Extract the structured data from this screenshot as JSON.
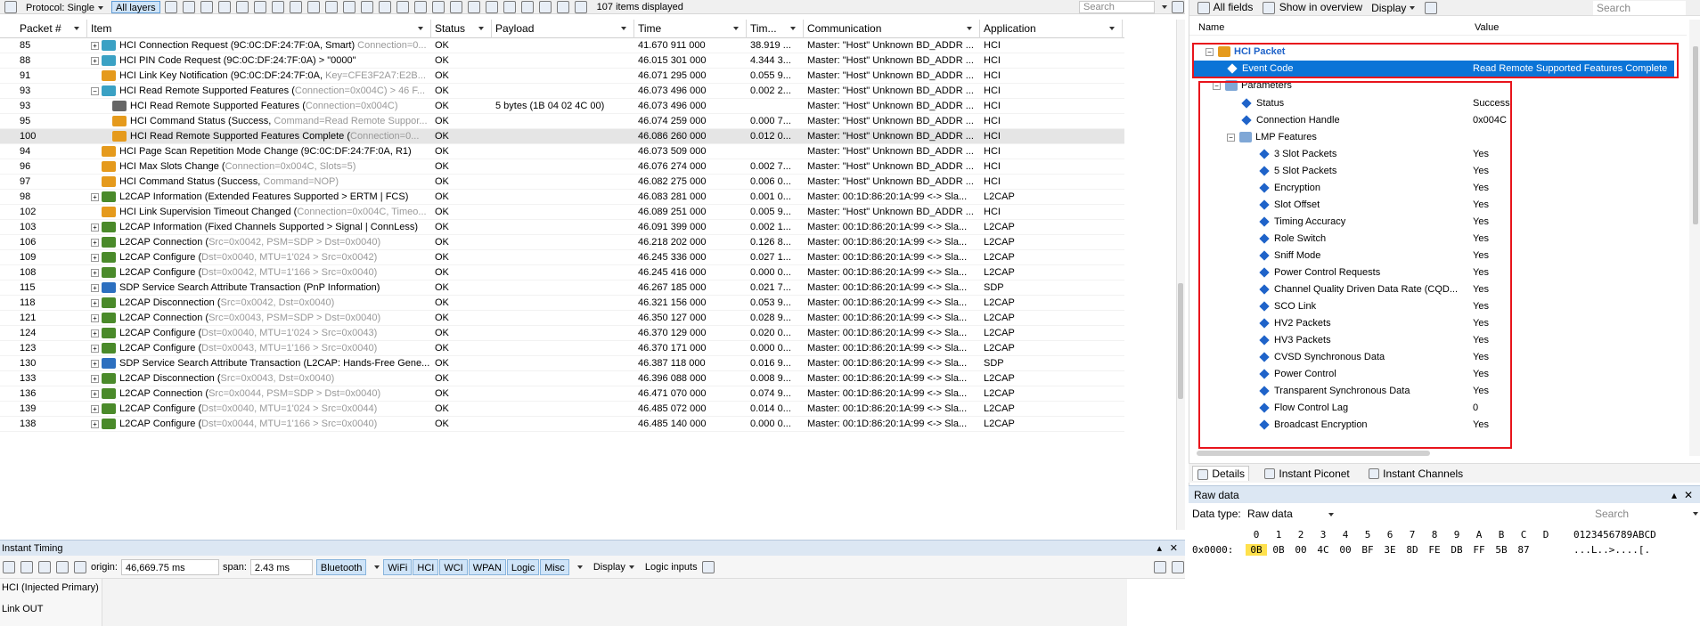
{
  "toolbar": {
    "protocol_label": "Protocol: Single",
    "layers_label": "All layers",
    "items_displayed": "107 items displayed",
    "search_placeholder": "Search"
  },
  "grid": {
    "columns": [
      "Packet #",
      "Item",
      "Status",
      "Payload",
      "Time",
      "Tim...",
      "Communication",
      "Application"
    ],
    "rows": [
      {
        "pkt": "85",
        "exp": "+",
        "indent": 0,
        "icon": "link",
        "item": "HCI Connection Request (9C:0C:DF:24:7F:0A, Smart)",
        "extra": " Connection=0...",
        "status": "OK",
        "payload": "",
        "time": "41.670 911 000",
        "tim": "38.919 ...",
        "comm": "Master: \"Host\" Unknown BD_ADDR ...",
        "app": "HCI",
        "sel": false
      },
      {
        "pkt": "88",
        "exp": "+",
        "indent": 0,
        "icon": "link",
        "item": "HCI PIN Code Request (9C:0C:DF:24:7F:0A) > \"0000\"",
        "extra": "",
        "status": "OK",
        "payload": "",
        "time": "46.015 301 000",
        "tim": "4.344 3...",
        "comm": "Master: \"Host\" Unknown BD_ADDR ...",
        "app": "HCI",
        "sel": false
      },
      {
        "pkt": "91",
        "exp": "",
        "indent": 0,
        "icon": "event",
        "item": "HCI Link Key Notification (9C:0C:DF:24:7F:0A, ",
        "extra": "Key=CFE3F2A7:E2B...",
        "status": "OK",
        "payload": "",
        "time": "46.071 295 000",
        "tim": "0.055 9...",
        "comm": "Master: \"Host\" Unknown BD_ADDR ...",
        "app": "HCI",
        "sel": false
      },
      {
        "pkt": "93",
        "exp": "-",
        "indent": 0,
        "icon": "link",
        "item": "HCI Read Remote Supported Features (",
        "extra": "Connection=0x004C) > 46 F...",
        "status": "OK",
        "payload": "",
        "time": "46.073 496 000",
        "tim": "0.002 2...",
        "comm": "Master: \"Host\" Unknown BD_ADDR ...",
        "app": "HCI",
        "sel": false
      },
      {
        "pkt": "93",
        "exp": "",
        "indent": 1,
        "icon": "arrow",
        "item": "HCI Read Remote Supported Features (",
        "extra": "Connection=0x004C)",
        "status": "OK",
        "payload": "5 bytes (1B 04 02 4C 00)",
        "time": "46.073 496 000",
        "tim": "",
        "comm": "Master: \"Host\" Unknown BD_ADDR ...",
        "app": "HCI",
        "sel": false
      },
      {
        "pkt": "95",
        "exp": "",
        "indent": 1,
        "icon": "event",
        "item": "HCI Command Status (Success, ",
        "extra": "Command=Read Remote Suppor...",
        "status": "OK",
        "payload": "",
        "time": "46.074 259 000",
        "tim": "0.000 7...",
        "comm": "Master: \"Host\" Unknown BD_ADDR ...",
        "app": "HCI",
        "sel": false
      },
      {
        "pkt": "100",
        "exp": "",
        "indent": 1,
        "icon": "event",
        "item": "HCI Read Remote Supported Features Complete (",
        "extra": "Connection=0...",
        "status": "OK",
        "payload": "",
        "time": "46.086 260 000",
        "tim": "0.012 0...",
        "comm": "Master: \"Host\" Unknown BD_ADDR ...",
        "app": "HCI",
        "sel": true
      },
      {
        "pkt": "94",
        "exp": "",
        "indent": 0,
        "icon": "event",
        "item": "HCI Page Scan Repetition Mode Change (9C:0C:DF:24:7F:0A, R1)",
        "extra": "",
        "status": "OK",
        "payload": "",
        "time": "46.073 509 000",
        "tim": "",
        "comm": "Master: \"Host\" Unknown BD_ADDR ...",
        "app": "HCI",
        "sel": false
      },
      {
        "pkt": "96",
        "exp": "",
        "indent": 0,
        "icon": "event",
        "item": "HCI Max Slots Change (",
        "extra": "Connection=0x004C, Slots=5)",
        "status": "OK",
        "payload": "",
        "time": "46.076 274 000",
        "tim": "0.002 7...",
        "comm": "Master: \"Host\" Unknown BD_ADDR ...",
        "app": "HCI",
        "sel": false
      },
      {
        "pkt": "97",
        "exp": "",
        "indent": 0,
        "icon": "event",
        "item": "HCI Command Status (Success, ",
        "extra": "Command=NOP)",
        "status": "OK",
        "payload": "",
        "time": "46.082 275 000",
        "tim": "0.006 0...",
        "comm": "Master: \"Host\" Unknown BD_ADDR ...",
        "app": "HCI",
        "sel": false
      },
      {
        "pkt": "98",
        "exp": "+",
        "indent": 0,
        "icon": "l2cap",
        "item": "L2CAP Information (Extended Features Supported > ERTM | FCS)",
        "extra": "",
        "status": "OK",
        "payload": "",
        "time": "46.083 281 000",
        "tim": "0.001 0...",
        "comm": "Master: 00:1D:86:20:1A:99 <-> Sla...",
        "app": "L2CAP",
        "sel": false
      },
      {
        "pkt": "102",
        "exp": "",
        "indent": 0,
        "icon": "event",
        "item": "HCI Link Supervision Timeout Changed (",
        "extra": "Connection=0x004C, Timeo...",
        "status": "OK",
        "payload": "",
        "time": "46.089 251 000",
        "tim": "0.005 9...",
        "comm": "Master: \"Host\" Unknown BD_ADDR ...",
        "app": "HCI",
        "sel": false
      },
      {
        "pkt": "103",
        "exp": "+",
        "indent": 0,
        "icon": "l2cap",
        "item": "L2CAP Information (Fixed Channels Supported > Signal | ConnLess)",
        "extra": "",
        "status": "OK",
        "payload": "",
        "time": "46.091 399 000",
        "tim": "0.002 1...",
        "comm": "Master: 00:1D:86:20:1A:99 <-> Sla...",
        "app": "L2CAP",
        "sel": false
      },
      {
        "pkt": "106",
        "exp": "+",
        "indent": 0,
        "icon": "l2cap",
        "item": "L2CAP Connection (",
        "extra": "Src=0x0042, PSM=SDP > Dst=0x0040)",
        "status": "OK",
        "payload": "",
        "time": "46.218 202 000",
        "tim": "0.126 8...",
        "comm": "Master: 00:1D:86:20:1A:99 <-> Sla...",
        "app": "L2CAP",
        "sel": false
      },
      {
        "pkt": "109",
        "exp": "+",
        "indent": 0,
        "icon": "l2cap",
        "item": "L2CAP Configure (",
        "extra": "Dst=0x0040, MTU=1'024 > Src=0x0042)",
        "status": "OK",
        "payload": "",
        "time": "46.245 336 000",
        "tim": "0.027 1...",
        "comm": "Master: 00:1D:86:20:1A:99 <-> Sla...",
        "app": "L2CAP",
        "sel": false
      },
      {
        "pkt": "108",
        "exp": "+",
        "indent": 0,
        "icon": "l2cap",
        "item": "L2CAP Configure (",
        "extra": "Dst=0x0042, MTU=1'166 > Src=0x0040)",
        "status": "OK",
        "payload": "",
        "time": "46.245 416 000",
        "tim": "0.000 0...",
        "comm": "Master: 00:1D:86:20:1A:99 <-> Sla...",
        "app": "L2CAP",
        "sel": false
      },
      {
        "pkt": "115",
        "exp": "+",
        "indent": 0,
        "icon": "sdp",
        "item": "SDP Service Search Attribute Transaction (PnP Information)",
        "extra": "",
        "status": "OK",
        "payload": "",
        "time": "46.267 185 000",
        "tim": "0.021 7...",
        "comm": "Master: 00:1D:86:20:1A:99 <-> Sla...",
        "app": "SDP",
        "sel": false
      },
      {
        "pkt": "118",
        "exp": "+",
        "indent": 0,
        "icon": "l2cap",
        "item": "L2CAP Disconnection (",
        "extra": "Src=0x0042, Dst=0x0040)",
        "status": "OK",
        "payload": "",
        "time": "46.321 156 000",
        "tim": "0.053 9...",
        "comm": "Master: 00:1D:86:20:1A:99 <-> Sla...",
        "app": "L2CAP",
        "sel": false
      },
      {
        "pkt": "121",
        "exp": "+",
        "indent": 0,
        "icon": "l2cap",
        "item": "L2CAP Connection (",
        "extra": "Src=0x0043, PSM=SDP > Dst=0x0040)",
        "status": "OK",
        "payload": "",
        "time": "46.350 127 000",
        "tim": "0.028 9...",
        "comm": "Master: 00:1D:86:20:1A:99 <-> Sla...",
        "app": "L2CAP",
        "sel": false
      },
      {
        "pkt": "124",
        "exp": "+",
        "indent": 0,
        "icon": "l2cap",
        "item": "L2CAP Configure (",
        "extra": "Dst=0x0040, MTU=1'024 > Src=0x0043)",
        "status": "OK",
        "payload": "",
        "time": "46.370 129 000",
        "tim": "0.020 0...",
        "comm": "Master: 00:1D:86:20:1A:99 <-> Sla...",
        "app": "L2CAP",
        "sel": false
      },
      {
        "pkt": "123",
        "exp": "+",
        "indent": 0,
        "icon": "l2cap",
        "item": "L2CAP Configure (",
        "extra": "Dst=0x0043, MTU=1'166 > Src=0x0040)",
        "status": "OK",
        "payload": "",
        "time": "46.370 171 000",
        "tim": "0.000 0...",
        "comm": "Master: 00:1D:86:20:1A:99 <-> Sla...",
        "app": "L2CAP",
        "sel": false
      },
      {
        "pkt": "130",
        "exp": "+",
        "indent": 0,
        "icon": "sdp",
        "item": "SDP Service Search Attribute Transaction (L2CAP: Hands-Free Gene...",
        "extra": "",
        "status": "OK",
        "payload": "",
        "time": "46.387 118 000",
        "tim": "0.016 9...",
        "comm": "Master: 00:1D:86:20:1A:99 <-> Sla...",
        "app": "SDP",
        "sel": false
      },
      {
        "pkt": "133",
        "exp": "+",
        "indent": 0,
        "icon": "l2cap",
        "item": "L2CAP Disconnection (",
        "extra": "Src=0x0043, Dst=0x0040)",
        "status": "OK",
        "payload": "",
        "time": "46.396 088 000",
        "tim": "0.008 9...",
        "comm": "Master: 00:1D:86:20:1A:99 <-> Sla...",
        "app": "L2CAP",
        "sel": false
      },
      {
        "pkt": "136",
        "exp": "+",
        "indent": 0,
        "icon": "l2cap",
        "item": "L2CAP Connection (",
        "extra": "Src=0x0044, PSM=SDP > Dst=0x0040)",
        "status": "OK",
        "payload": "",
        "time": "46.471 070 000",
        "tim": "0.074 9...",
        "comm": "Master: 00:1D:86:20:1A:99 <-> Sla...",
        "app": "L2CAP",
        "sel": false
      },
      {
        "pkt": "139",
        "exp": "+",
        "indent": 0,
        "icon": "l2cap",
        "item": "L2CAP Configure (",
        "extra": "Dst=0x0040, MTU=1'024 > Src=0x0044)",
        "status": "OK",
        "payload": "",
        "time": "46.485 072 000",
        "tim": "0.014 0...",
        "comm": "Master: 00:1D:86:20:1A:99 <-> Sla...",
        "app": "L2CAP",
        "sel": false
      },
      {
        "pkt": "138",
        "exp": "+",
        "indent": 0,
        "icon": "l2cap",
        "item": "L2CAP Configure (",
        "extra": "Dst=0x0044, MTU=1'166 > Src=0x0040)",
        "status": "OK",
        "payload": "",
        "time": "46.485 140 000",
        "tim": "0.000 0...",
        "comm": "Master: 00:1D:86:20:1A:99 <-> Sla...",
        "app": "L2CAP",
        "sel": false
      }
    ]
  },
  "timing": {
    "title": "Instant Timing",
    "origin_label": "origin:",
    "origin_value": "46,669.75 ms",
    "span_label": "span:",
    "span_value": "2.43 ms",
    "bluetooth": "Bluetooth",
    "toggles": [
      "WiFi",
      "HCI",
      "WCI",
      "WPAN",
      "Logic",
      "Misc"
    ],
    "display": "Display",
    "logic_inputs": "Logic inputs",
    "track1": "HCI (Injected Primary)",
    "track2": "Link OUT"
  },
  "details": {
    "toolbar": {
      "all_fields": "All fields",
      "show_overview": "Show in overview",
      "display": "Display",
      "search_placeholder": "Search"
    },
    "col_name": "Name",
    "col_value": "Value",
    "root": "HCI Packet",
    "event_code_name": "Event Code",
    "event_code_value": "Read Remote Supported Features Complete",
    "parameters": "Parameters",
    "params": [
      {
        "name": "Status",
        "value": "Success"
      },
      {
        "name": "Connection Handle",
        "value": "0x004C"
      }
    ],
    "lmp": "LMP Features",
    "features": [
      {
        "name": "3 Slot Packets",
        "value": "Yes"
      },
      {
        "name": "5 Slot Packets",
        "value": "Yes"
      },
      {
        "name": "Encryption",
        "value": "Yes"
      },
      {
        "name": "Slot Offset",
        "value": "Yes"
      },
      {
        "name": "Timing Accuracy",
        "value": "Yes"
      },
      {
        "name": "Role Switch",
        "value": "Yes"
      },
      {
        "name": "Sniff Mode",
        "value": "Yes"
      },
      {
        "name": "Power Control Requests",
        "value": "Yes"
      },
      {
        "name": "Channel Quality Driven Data Rate (CQD...",
        "value": "Yes"
      },
      {
        "name": "SCO Link",
        "value": "Yes"
      },
      {
        "name": "HV2 Packets",
        "value": "Yes"
      },
      {
        "name": "HV3 Packets",
        "value": "Yes"
      },
      {
        "name": "CVSD Synchronous Data",
        "value": "Yes"
      },
      {
        "name": "Power Control",
        "value": "Yes"
      },
      {
        "name": "Transparent Synchronous Data",
        "value": "Yes"
      },
      {
        "name": "Flow Control Lag",
        "value": "0"
      },
      {
        "name": "Broadcast Encryption",
        "value": "Yes"
      }
    ],
    "tabs": [
      "Details",
      "Instant Piconet",
      "Instant Channels"
    ]
  },
  "raw": {
    "title": "Raw data",
    "type_label": "Data type:",
    "type_value": "Raw data",
    "search_placeholder": "Search",
    "columns": [
      "0",
      "1",
      "2",
      "3",
      "4",
      "5",
      "6",
      "7",
      "8",
      "9",
      "A",
      "B",
      "C",
      "D"
    ],
    "ascii_header": "0123456789ABCD",
    "offset": "0x0000:",
    "bytes": [
      "0B",
      "0B",
      "00",
      "4C",
      "00",
      "BF",
      "3E",
      "8D",
      "FE",
      "DB",
      "FF",
      "5B",
      "87"
    ],
    "ascii": "...L..>....[."
  },
  "colors": {
    "selected_row": "#e5e5e5",
    "tree_selected": "#0b74d7",
    "annotation_red": "#e8141c",
    "hex_highlight": "#ffe14d"
  }
}
